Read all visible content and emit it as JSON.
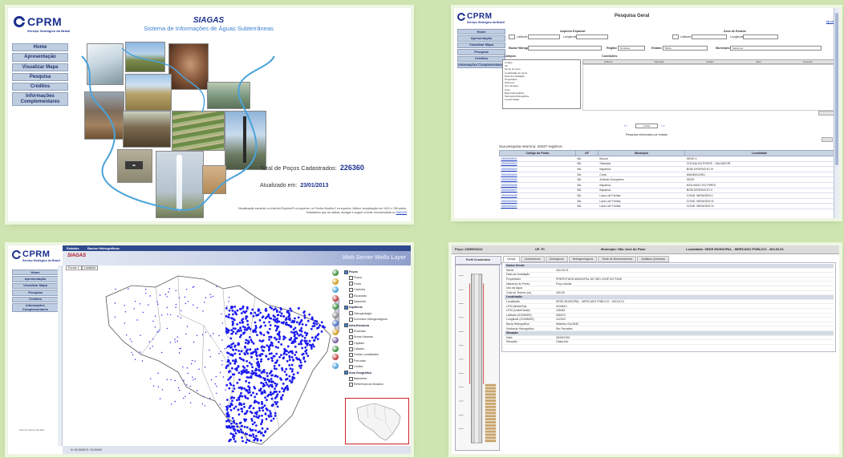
{
  "page": {
    "background": "#cfe5b1",
    "accent": "#1a2f8f",
    "link_color": "#1a3fbf"
  },
  "logo": {
    "name": "CPRM",
    "subtitle": "Serviço Geológico do Brasil"
  },
  "home": {
    "title": "SIAGAS",
    "subtitle": "Sistema de Informações de Águas Subterrâneas",
    "menu": [
      "Home",
      "Apresentação",
      "Visualizar Mapa",
      "Pesquisa",
      "Créditos",
      "Informações Complementares"
    ],
    "stats_label": "Total de Poços Cadastrados:",
    "stats_value": "226360",
    "updated_label": "Atualizado em:",
    "updated_value": "23/01/2013",
    "footnote_line1": "Visualização somente no Internet Explorer® ou superior, no Firefox Mozilla 2 ou superior. Melhor visualização em 1024 x 768 pixels.",
    "footnote_line2": "Solicitamos que ao utilizar, divulgar e sugerir a fonte recomendada no",
    "footnote_link": "SIAGAS"
  },
  "query": {
    "title": "Pesquisa Geral",
    "help_link": "Ajuda",
    "menu": [
      "Home",
      "Apresentação",
      "Visualizar Mapa",
      "Pesquisa",
      "Créditos",
      "Informações Complementares"
    ],
    "section_left": "Aspecto Espacial",
    "section_right": "Área de Estudo",
    "lat_label": "Latitude",
    "lon_label": "Longitude",
    "basin_label": "Bacia Hidrográfica",
    "region_label": "Região",
    "region_value": "Nordeste",
    "state_label": "Estado",
    "state_value": "Bahia",
    "city_label": "Município",
    "city_value": "Selecione",
    "field_header": "Campos",
    "conditions_header": "Condições",
    "cond_columns": [
      "Atributo",
      "Operador",
      "Critério",
      "Valor",
      "Conector"
    ],
    "fields": [
      "Código",
      "UF",
      "Nome do poço",
      "Localização do ponto",
      "Data de instalação",
      "Proprietário",
      "Natureza",
      "Uso da água",
      "Cota",
      "Bacia hidrográfica",
      "Sub-bacia hidrográfica",
      "Coordenadas"
    ],
    "results_per_page": "Linhas",
    "no_result_msg": "Pesquisa elaborada por estado",
    "result_title": "Sua pesquisa retornou: 20427 registros",
    "result_columns": [
      "Código do Ponto",
      "UF",
      "Município",
      "Localidade"
    ],
    "rows": [
      {
        "cod": "2900000001",
        "uf": "BA",
        "mun": "Mucuri",
        "loc": "SEDE II"
      },
      {
        "cod": "2900000002",
        "uf": "BA",
        "mun": "Salvador",
        "loc": "COLINA DA PONTE - SALVADOR"
      },
      {
        "cod": "2900000003",
        "uf": "BA",
        "mun": "Itaparica",
        "loc": "BOM DESPACHO III"
      },
      {
        "cod": "2900000004",
        "uf": "BA",
        "mun": "Cotia",
        "loc": "MANDACARU"
      },
      {
        "cod": "2900000005",
        "uf": "BA",
        "mun": "Antônio Gonçalves",
        "loc": "SEDE"
      },
      {
        "cod": "2900000006",
        "uf": "BA",
        "mun": "Itaparica",
        "loc": "MOLHADO DO PIRES"
      },
      {
        "cod": "2900000007",
        "uf": "BA",
        "mun": "Itaparica",
        "loc": "BOM DESPACHO II"
      },
      {
        "cod": "2900000008",
        "uf": "BA",
        "mun": "Lauro de Freitas",
        "loc": "COND. MIRAGEM II"
      },
      {
        "cod": "2900000009",
        "uf": "BA",
        "mun": "Lauro de Freitas",
        "loc": "COND. MIRAGEM III"
      },
      {
        "cod": "2900000010",
        "uf": "BA",
        "mun": "Lauro de Freitas",
        "loc": "COND. MIRAGEM IV"
      }
    ]
  },
  "map": {
    "tabs": [
      "Estados",
      "Bacias Hidrográficas"
    ],
    "menu": [
      "Home",
      "Apresentação",
      "Visualizar Mapa",
      "Pesquisa",
      "Créditos",
      "Informações Complementares"
    ],
    "header_logo": "SIAGAS",
    "header_title": "Web Server Wells Layer",
    "ctl_1": "Escala 1:",
    "ctl_2": "Localizar",
    "zoom_ctl": "Zoom In   Zoom Out   Pan",
    "status": "N: 00,00000   E: 00,00000",
    "point_color": "#1a1af0",
    "layers": [
      {
        "label": "Poços",
        "group": true
      },
      {
        "label": "Poços",
        "group": false
      },
      {
        "label": "Fonte",
        "group": false
      },
      {
        "label": "Cacimba",
        "group": false
      },
      {
        "label": "Escavado",
        "group": false
      },
      {
        "label": "Nascente",
        "group": false
      },
      {
        "label": "Aquíferos",
        "group": true
      },
      {
        "label": "Hidrogeologia",
        "group": false
      },
      {
        "label": "Domínios Hidrogeológicos",
        "group": false
      },
      {
        "label": "Infra-Estrutura",
        "group": true
      },
      {
        "label": "Rodovias",
        "group": false
      },
      {
        "label": "Áreas Urbanas",
        "group": false
      },
      {
        "label": "Capitais",
        "group": false
      },
      {
        "label": "Cidades",
        "group": false
      },
      {
        "label": "Outras Localidades",
        "group": false
      },
      {
        "label": "Ferrovias",
        "group": false
      },
      {
        "label": "Limites",
        "group": false
      },
      {
        "label": "Área Geográfica",
        "group": true
      },
      {
        "label": "Batimetria",
        "group": false
      },
      {
        "label": "Referência do Mosaico",
        "group": false
      }
    ]
  },
  "detail": {
    "well_label": "Poço: 2300000412",
    "uf_label": "UF: PI",
    "city_label": "Município: São José do Piauí",
    "loc_label": "Localidade: SEDE MUNICIPAL - MERCADO PÚBLICO - 400.04.01",
    "left_title": "Perfil Construtivo",
    "tabs": [
      "Gerais",
      "Construtivos",
      "Geológicos",
      "Hidrogeológicos",
      "Teste de Bombeamento",
      "Análises Químicas"
    ],
    "sections": [
      {
        "title": "Dados Gerais",
        "rows": [
          [
            "Nome",
            "400.04.01"
          ],
          [
            "Data da Instalação",
            ""
          ],
          [
            "Proprietário",
            "PREFEITURA MUNICIPAL DE SÃO JOSÉ DO PIAUÍ"
          ],
          [
            "Natureza do Ponto",
            "Poço tubular"
          ],
          [
            "Uso da Água",
            ""
          ],
          [
            "Cota do Terreno (m)",
            "400.00"
          ]
        ]
      },
      {
        "title": "Localização",
        "rows": [
          [
            "Localidade",
            "SEDE MUNICIPAL - MERCADO PÚBLICO - 400.04.01"
          ],
          [
            "UTM (Norte/Sul)",
            "9239613"
          ],
          [
            "UTM (Leste/Oeste)",
            "228451"
          ],
          [
            "Latitude (GGMMSS)",
            "065224"
          ],
          [
            "Longitude (GGMMSS)",
            "412043"
          ],
          [
            "Bacia Hidrográfica",
            "Atlântico Sul-NNE"
          ],
          [
            "Subbacia Hidrográfica",
            "Rio Parnaíba"
          ]
        ]
      },
      {
        "title": "Situação",
        "rows": [
          [
            "Data",
            "06/05/1991"
          ],
          [
            "Situação",
            "Obstruído"
          ]
        ]
      }
    ]
  }
}
